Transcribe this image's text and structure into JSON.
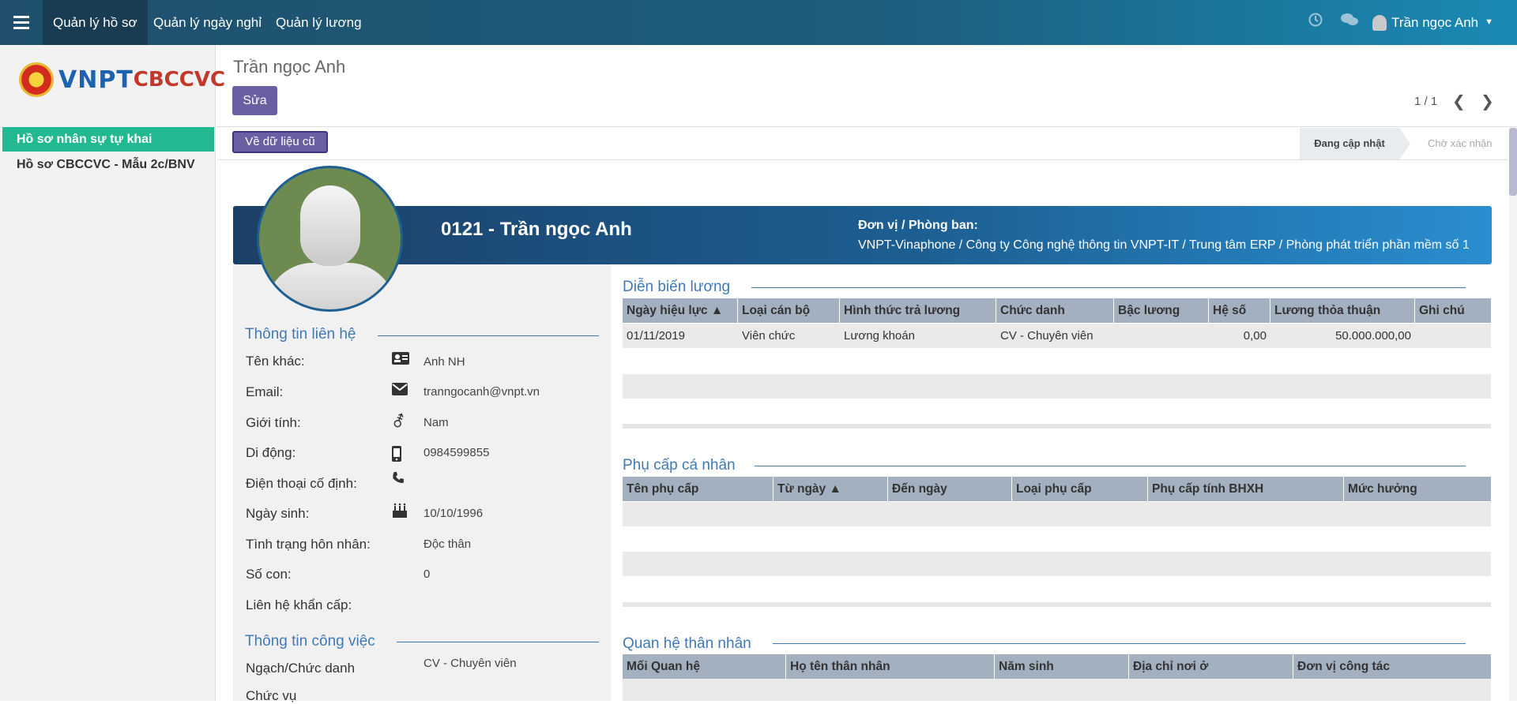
{
  "nav": {
    "menu": [
      "Quản lý hồ sơ",
      "Quản lý ngày nghỉ",
      "Quản lý lương"
    ],
    "user_name": "Trần ngọc Anh",
    "icons": [
      "clock-icon",
      "chat-icon",
      "user-avatar"
    ]
  },
  "sidebar": {
    "logo_vnpt": "VNPT",
    "logo_cbccvc": "CBCCVC",
    "items": [
      "Hồ sơ nhân sự tự khai",
      "Hồ sơ CBCCVC - Mẫu 2c/BNV"
    ]
  },
  "control": {
    "title": "Trần ngọc Anh",
    "edit_label": "Sửa",
    "pager": "1 / 1"
  },
  "statusbar": {
    "old_data_label": "Về dữ liệu cũ",
    "stages": [
      "Đang cập nhật",
      "Chờ xác nhận"
    ]
  },
  "employee": {
    "code_name": "0121 - Trần ngọc Anh",
    "dept_label": "Đơn vị / Phòng ban:",
    "dept_value": "VNPT-Vinaphone / Công ty Công nghệ thông tin VNPT-IT / Trung tâm ERP / Phòng phát triển phần mềm số 1"
  },
  "contact": {
    "title": "Thông tin liên hệ",
    "fields": [
      {
        "label": "Tên khác:",
        "icon": "id-card-icon",
        "value": "Anh NH"
      },
      {
        "label": "Email:",
        "icon": "envelope-icon",
        "value": "tranngocanh@vnpt.vn"
      },
      {
        "label": "Giới tính:",
        "icon": "gender-icon",
        "value": "Nam"
      },
      {
        "label": "Di động:",
        "icon": "mobile-icon",
        "value": "0984599855"
      },
      {
        "label": "Điện thoại cố định:",
        "icon": "phone-icon",
        "value": ""
      },
      {
        "label": "Ngày sinh:",
        "icon": "birthday-cake-icon",
        "value": "10/10/1996"
      },
      {
        "label": "Tình trạng hôn nhân:",
        "icon": "",
        "value": "Độc thân"
      },
      {
        "label": "Số con:",
        "icon": "",
        "value": "0"
      },
      {
        "label": "Liên hệ khẩn cấp:",
        "icon": "",
        "value": ""
      }
    ]
  },
  "work": {
    "title": "Thông tin công việc",
    "fields": [
      {
        "label": "Ngạch/Chức danh",
        "value": "CV - Chuyên viên"
      },
      {
        "label": "Chức vụ",
        "value": ""
      }
    ]
  },
  "salary": {
    "title": "Diễn biến lương",
    "headers": [
      "Ngày hiệu lực ▲",
      "Loại cán bộ",
      "Hình thức trả lương",
      "Chức danh",
      "Bậc lương",
      "Hệ số",
      "Lương thỏa thuận",
      "Ghi chú"
    ],
    "rows": [
      [
        "01/11/2019",
        "Viên chức",
        "Lương khoán",
        "CV - Chuyên viên",
        "",
        "0,00",
        "50.000.000,00",
        ""
      ]
    ]
  },
  "allowance": {
    "title": "Phụ cấp cá nhân",
    "headers": [
      "Tên phụ cấp",
      "Từ ngày ▲",
      "Đến ngày",
      "Loại phụ cấp",
      "Phụ cấp tính BHXH",
      "Mức hưởng"
    ]
  },
  "family": {
    "title": "Quan hệ thân nhân",
    "headers": [
      "Mối Quan hệ",
      "Họ tên thân nhân",
      "Năm sinh",
      "Địa chỉ nơi ở",
      "Đơn vị công tác"
    ]
  }
}
